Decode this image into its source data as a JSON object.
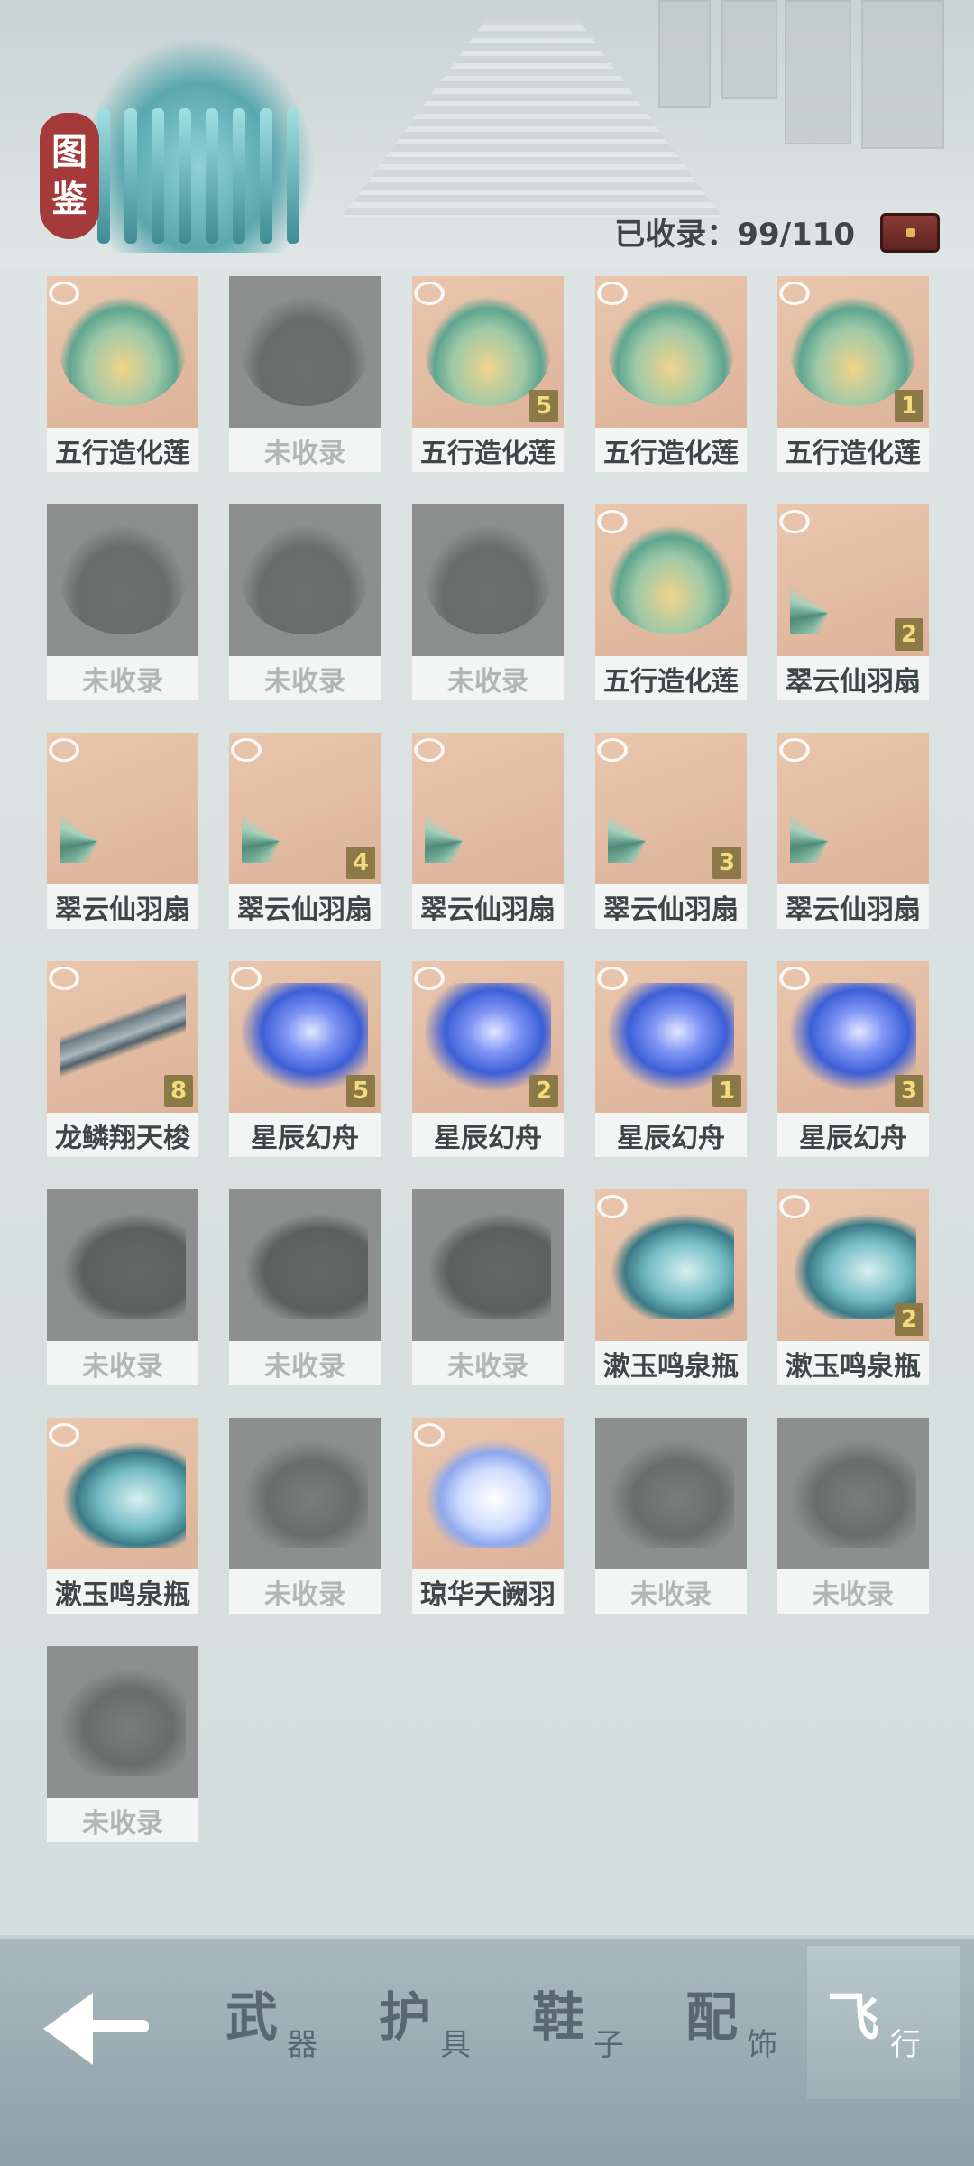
{
  "header": {
    "badge_chars": [
      "图",
      "鉴"
    ],
    "collected_label": "已收录：",
    "collected_count": "99/110",
    "chest_icon": "chest-icon"
  },
  "grid": {
    "items": [
      {
        "label": "五行造化莲",
        "owned": true,
        "art": "lotus",
        "count": ""
      },
      {
        "label": "未收录",
        "owned": false,
        "art": "lotus",
        "count": ""
      },
      {
        "label": "五行造化莲",
        "owned": true,
        "art": "lotus",
        "count": "5"
      },
      {
        "label": "五行造化莲",
        "owned": true,
        "art": "lotus",
        "count": ""
      },
      {
        "label": "五行造化莲",
        "owned": true,
        "art": "lotus",
        "count": "1"
      },
      {
        "label": "未收录",
        "owned": false,
        "art": "lotus",
        "count": ""
      },
      {
        "label": "未收录",
        "owned": false,
        "art": "lotus",
        "count": ""
      },
      {
        "label": "未收录",
        "owned": false,
        "art": "lotus",
        "count": ""
      },
      {
        "label": "五行造化莲",
        "owned": true,
        "art": "lotus",
        "count": ""
      },
      {
        "label": "翠云仙羽扇",
        "owned": true,
        "art": "fan",
        "count": "2"
      },
      {
        "label": "翠云仙羽扇",
        "owned": true,
        "art": "fan",
        "count": ""
      },
      {
        "label": "翠云仙羽扇",
        "owned": true,
        "art": "fan",
        "count": "4"
      },
      {
        "label": "翠云仙羽扇",
        "owned": true,
        "art": "fan",
        "count": ""
      },
      {
        "label": "翠云仙羽扇",
        "owned": true,
        "art": "fan",
        "count": "3"
      },
      {
        "label": "翠云仙羽扇",
        "owned": true,
        "art": "fan",
        "count": ""
      },
      {
        "label": "龙鳞翔天梭",
        "owned": true,
        "art": "boat",
        "count": "8"
      },
      {
        "label": "星辰幻舟",
        "owned": true,
        "art": "star",
        "count": "5"
      },
      {
        "label": "星辰幻舟",
        "owned": true,
        "art": "star",
        "count": "2"
      },
      {
        "label": "星辰幻舟",
        "owned": true,
        "art": "star",
        "count": "1"
      },
      {
        "label": "星辰幻舟",
        "owned": true,
        "art": "star",
        "count": "3"
      },
      {
        "label": "未收录",
        "owned": false,
        "art": "bottle",
        "count": ""
      },
      {
        "label": "未收录",
        "owned": false,
        "art": "bottle",
        "count": ""
      },
      {
        "label": "未收录",
        "owned": false,
        "art": "bottle",
        "count": ""
      },
      {
        "label": "漱玉鸣泉瓶",
        "owned": true,
        "art": "bottle",
        "count": ""
      },
      {
        "label": "漱玉鸣泉瓶",
        "owned": true,
        "art": "bottle",
        "count": "2"
      },
      {
        "label": "漱玉鸣泉瓶",
        "owned": true,
        "art": "bottle",
        "count": ""
      },
      {
        "label": "未收录",
        "owned": false,
        "art": "feather",
        "count": ""
      },
      {
        "label": "琼华天阙羽",
        "owned": true,
        "art": "feather",
        "count": ""
      },
      {
        "label": "未收录",
        "owned": false,
        "art": "feather",
        "count": ""
      },
      {
        "label": "未收录",
        "owned": false,
        "art": "feather",
        "count": ""
      },
      {
        "label": "未收录",
        "owned": false,
        "art": "feather",
        "count": ""
      }
    ]
  },
  "nav": {
    "back_icon": "back-arrow-icon",
    "tabs": [
      {
        "big": "武",
        "small": "器",
        "active": false
      },
      {
        "big": "护",
        "small": "具",
        "active": false
      },
      {
        "big": "鞋",
        "small": "子",
        "active": false
      },
      {
        "big": "配",
        "small": "饰",
        "active": false
      },
      {
        "big": "飞",
        "small": "行",
        "active": true
      }
    ]
  },
  "colors": {
    "owned_bg": "#e3bca3",
    "locked_bg": "#8d8f8f",
    "count_badge": "#8b7a48",
    "badge_red": "#a53a3a"
  }
}
